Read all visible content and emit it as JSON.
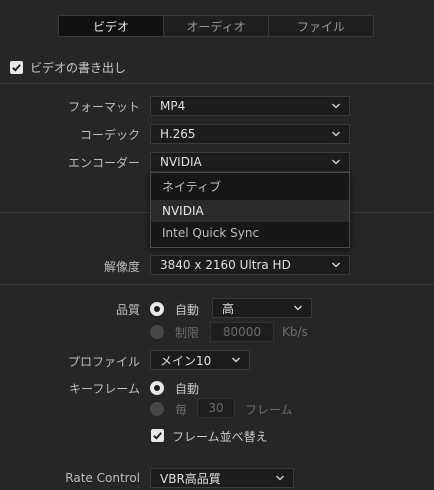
{
  "tabs": [
    {
      "label": "ビデオ",
      "active": true
    },
    {
      "label": "オーディオ",
      "active": false
    },
    {
      "label": "ファイル",
      "active": false
    }
  ],
  "export_video": {
    "label": "ビデオの書き出し",
    "checked": true
  },
  "format": {
    "label": "フォーマット",
    "value": "MP4"
  },
  "codec": {
    "label": "コーデック",
    "value": "H.265"
  },
  "encoder": {
    "label": "エンコーダー",
    "value": "NVIDIA",
    "options": [
      "ネイティブ",
      "NVIDIA",
      "Intel Quick Sync"
    ],
    "highlighted": "NVIDIA"
  },
  "resolution": {
    "label": "解像度",
    "value": "3840 x 2160 Ultra HD"
  },
  "quality": {
    "label": "品質",
    "auto_label": "自動",
    "auto_selected": true,
    "auto_value": "高",
    "limit_label": "制限",
    "limit_value": "80000",
    "limit_unit": "Kb/s"
  },
  "profile": {
    "label": "プロファイル",
    "value": "メイン10"
  },
  "keyframe": {
    "label": "キーフレーム",
    "auto_label": "自動",
    "auto_selected": true,
    "every_label": "毎",
    "every_value": "30",
    "every_unit": "フレーム"
  },
  "frame_reorder": {
    "label": "フレーム並べ替え",
    "checked": true
  },
  "rate_control": {
    "label": "Rate Control",
    "value": "VBR高品質"
  },
  "colors": {
    "panel_bg": "#262626",
    "field_bg": "#1c1c1c",
    "active_tab": "#111111",
    "dropdown_bg": "#171717"
  }
}
